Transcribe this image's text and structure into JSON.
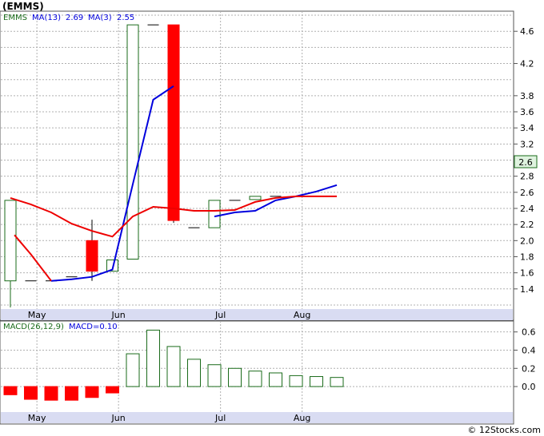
{
  "header": {
    "title": "(EMMS)"
  },
  "legend_price": {
    "symbol": "EMMS",
    "ma13_label": "MA(13)",
    "ma13_value": "2.69",
    "ma3_label": "MA(3)",
    "ma3_value": "2.55"
  },
  "legend_macd": {
    "label": "MACD(26,12,9)",
    "value_label": "MACD=0.10"
  },
  "last_price_tag": "2.6",
  "watermark": "© 12Stocks.com",
  "colors": {
    "up": "#1a6b1a",
    "down": "#ff0000",
    "ma13": "#0000dd",
    "ma3": "#ee0000",
    "grid": "#b0b0b0",
    "axis_band": "#d9dcf2"
  },
  "chart_data": [
    {
      "type": "candlestick",
      "title": "(EMMS)",
      "ylim": [
        1.15,
        4.85
      ],
      "y_ticks": [
        1.4,
        1.6,
        1.8,
        2.0,
        2.2,
        2.4,
        2.6,
        2.8,
        3.0,
        3.2,
        3.4,
        3.6,
        3.8,
        4.2,
        4.6
      ],
      "y_grid": [
        1.2,
        1.4,
        1.6,
        1.8,
        2.0,
        2.2,
        2.4,
        2.6,
        2.8,
        3.0,
        3.2,
        3.4,
        3.6,
        3.8,
        4.0,
        4.2,
        4.4,
        4.6,
        4.8
      ],
      "x_labels": [
        "May",
        "Jun",
        "Jul",
        "Aug"
      ],
      "x_label_positions": [
        1.3,
        5.3,
        10.3,
        14.3
      ],
      "candles": [
        {
          "i": 0,
          "open": 1.5,
          "high": 2.5,
          "low": 1.17,
          "close": 2.5
        },
        {
          "i": 1,
          "open": 1.5,
          "high": 1.5,
          "low": 1.5,
          "close": 1.5
        },
        {
          "i": 2,
          "open": 1.5,
          "high": 1.5,
          "low": 1.5,
          "close": 1.5
        },
        {
          "i": 3,
          "open": 1.55,
          "high": 1.55,
          "low": 1.55,
          "close": 1.55
        },
        {
          "i": 4,
          "open": 2.0,
          "high": 2.26,
          "low": 1.5,
          "close": 1.62
        },
        {
          "i": 5,
          "open": 1.62,
          "high": 1.62,
          "low": 1.62,
          "close": 1.76
        },
        {
          "i": 6,
          "open": 1.77,
          "high": 4.68,
          "low": 1.77,
          "close": 4.68
        },
        {
          "i": 7,
          "open": 4.68,
          "high": 4.68,
          "low": 4.68,
          "close": 4.68
        },
        {
          "i": 8,
          "open": 4.68,
          "high": 4.68,
          "low": 2.22,
          "close": 2.25
        },
        {
          "i": 9,
          "open": 2.16,
          "high": 2.16,
          "low": 2.16,
          "close": 2.16
        },
        {
          "i": 10,
          "open": 2.16,
          "high": 2.5,
          "low": 2.16,
          "close": 2.5
        },
        {
          "i": 11,
          "open": 2.5,
          "high": 2.5,
          "low": 2.5,
          "close": 2.5
        },
        {
          "i": 12,
          "open": 2.51,
          "high": 2.55,
          "low": 2.51,
          "close": 2.55
        },
        {
          "i": 13,
          "open": 2.55,
          "high": 2.55,
          "low": 2.55,
          "close": 2.55
        }
      ],
      "series": [
        {
          "name": "MA(13)",
          "x": [
            2,
            3,
            4,
            5,
            6,
            7,
            8,
            9,
            10,
            11,
            12,
            13,
            14,
            15,
            16
          ],
          "values": [
            1.5,
            1.52,
            1.55,
            1.64,
            2.7,
            3.75,
            3.92,
            null,
            2.3,
            2.35,
            2.37,
            2.5,
            2.55,
            2.61,
            2.69
          ]
        },
        {
          "name": "MA(3)",
          "x": [
            0,
            1,
            2,
            3,
            4,
            5,
            6,
            7,
            8,
            9,
            10,
            11,
            12,
            13,
            14,
            15,
            16
          ],
          "values": [
            2.53,
            2.45,
            2.35,
            2.21,
            2.12,
            2.05,
            2.3,
            2.42,
            2.4,
            2.37,
            2.37,
            2.38,
            2.48,
            2.53,
            2.55,
            2.55,
            2.55
          ]
        },
        {
          "name": "MA(3) early",
          "x": [
            0.2,
            1,
            2
          ],
          "values": [
            2.07,
            1.83,
            1.5
          ]
        }
      ]
    },
    {
      "type": "bar",
      "title": "MACD(26,12,9)",
      "ylim": [
        -0.28,
        0.72
      ],
      "y_ticks": [
        0.0,
        0.2,
        0.4,
        0.6
      ],
      "x_labels": [
        "May",
        "Jun",
        "Jul",
        "Aug"
      ],
      "x_label_positions": [
        1.3,
        5.3,
        10.3,
        14.3
      ],
      "x": [
        0,
        1,
        2,
        3,
        4,
        5,
        6,
        7,
        8,
        9,
        10,
        11,
        12,
        13,
        14,
        15,
        16
      ],
      "values": [
        -0.09,
        -0.14,
        -0.15,
        -0.15,
        -0.12,
        -0.07,
        0.36,
        0.62,
        0.44,
        0.3,
        0.24,
        0.2,
        0.17,
        0.15,
        0.12,
        0.11,
        0.1
      ]
    }
  ]
}
